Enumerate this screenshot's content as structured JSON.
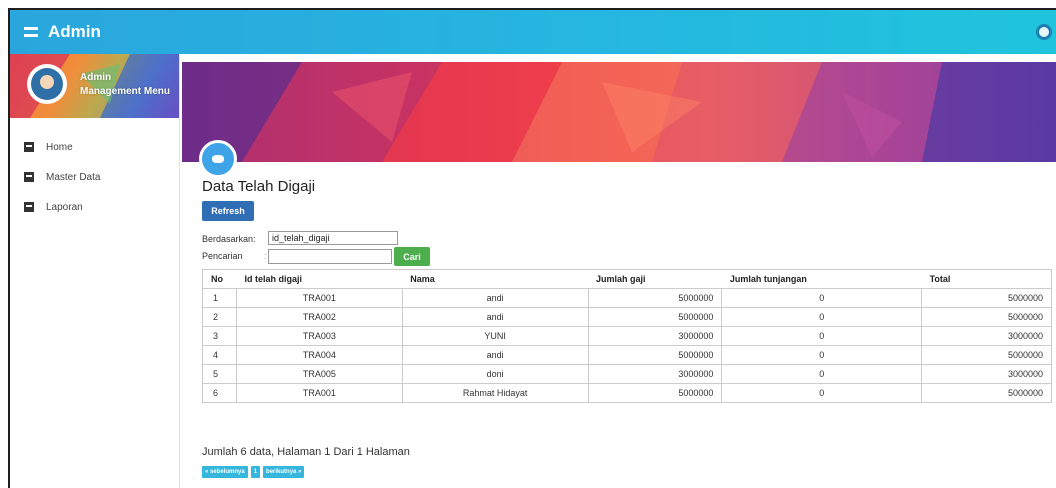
{
  "topbar": {
    "title": "Admin",
    "menu_icon": "menu-icon",
    "user_icon": "user-circle-icon"
  },
  "sidebar": {
    "user_name": "Admin",
    "user_subtitle": "Management Menu",
    "items": [
      {
        "label": "Home",
        "icon": "home-icon"
      },
      {
        "label": "Master Data",
        "icon": "list-icon"
      },
      {
        "label": "Laporan",
        "icon": "report-icon"
      }
    ]
  },
  "main": {
    "title": "Data Telah Digaji",
    "refresh_label": "Refresh",
    "berdasarkan_label": "Berdasarkan:",
    "berdasarkan_value": "id_telah_digaji",
    "pencarian_label": "Pencarian",
    "pencarian_colon": ":",
    "pencarian_value": "",
    "cari_label": "Cari",
    "table": {
      "headers": [
        "No",
        "Id telah digaji",
        "Nama",
        "Jumlah gaji",
        "Jumlah tunjangan",
        "Total"
      ],
      "rows": [
        [
          "1",
          "TRA001",
          "andi",
          "5000000",
          "0",
          "5000000"
        ],
        [
          "2",
          "TRA002",
          "andi",
          "5000000",
          "0",
          "5000000"
        ],
        [
          "3",
          "TRA003",
          "YUNI",
          "3000000",
          "0",
          "3000000"
        ],
        [
          "4",
          "TRA004",
          "andi",
          "5000000",
          "0",
          "5000000"
        ],
        [
          "5",
          "TRA005",
          "doni",
          "3000000",
          "0",
          "3000000"
        ],
        [
          "6",
          "TRA001",
          "Rahmat Hidayat",
          "5000000",
          "0",
          "5000000"
        ]
      ]
    },
    "summary": "Jumlah 6 data, Halaman 1 Dari 1 Halaman",
    "pager": {
      "prev": "« sebelumnya",
      "current": "1",
      "next": "berikutnya »"
    }
  },
  "colors": {
    "topbar": "#2aa6dd",
    "refresh": "#2f6db5",
    "cari": "#4cae4c",
    "pager": "#35b6dc"
  }
}
